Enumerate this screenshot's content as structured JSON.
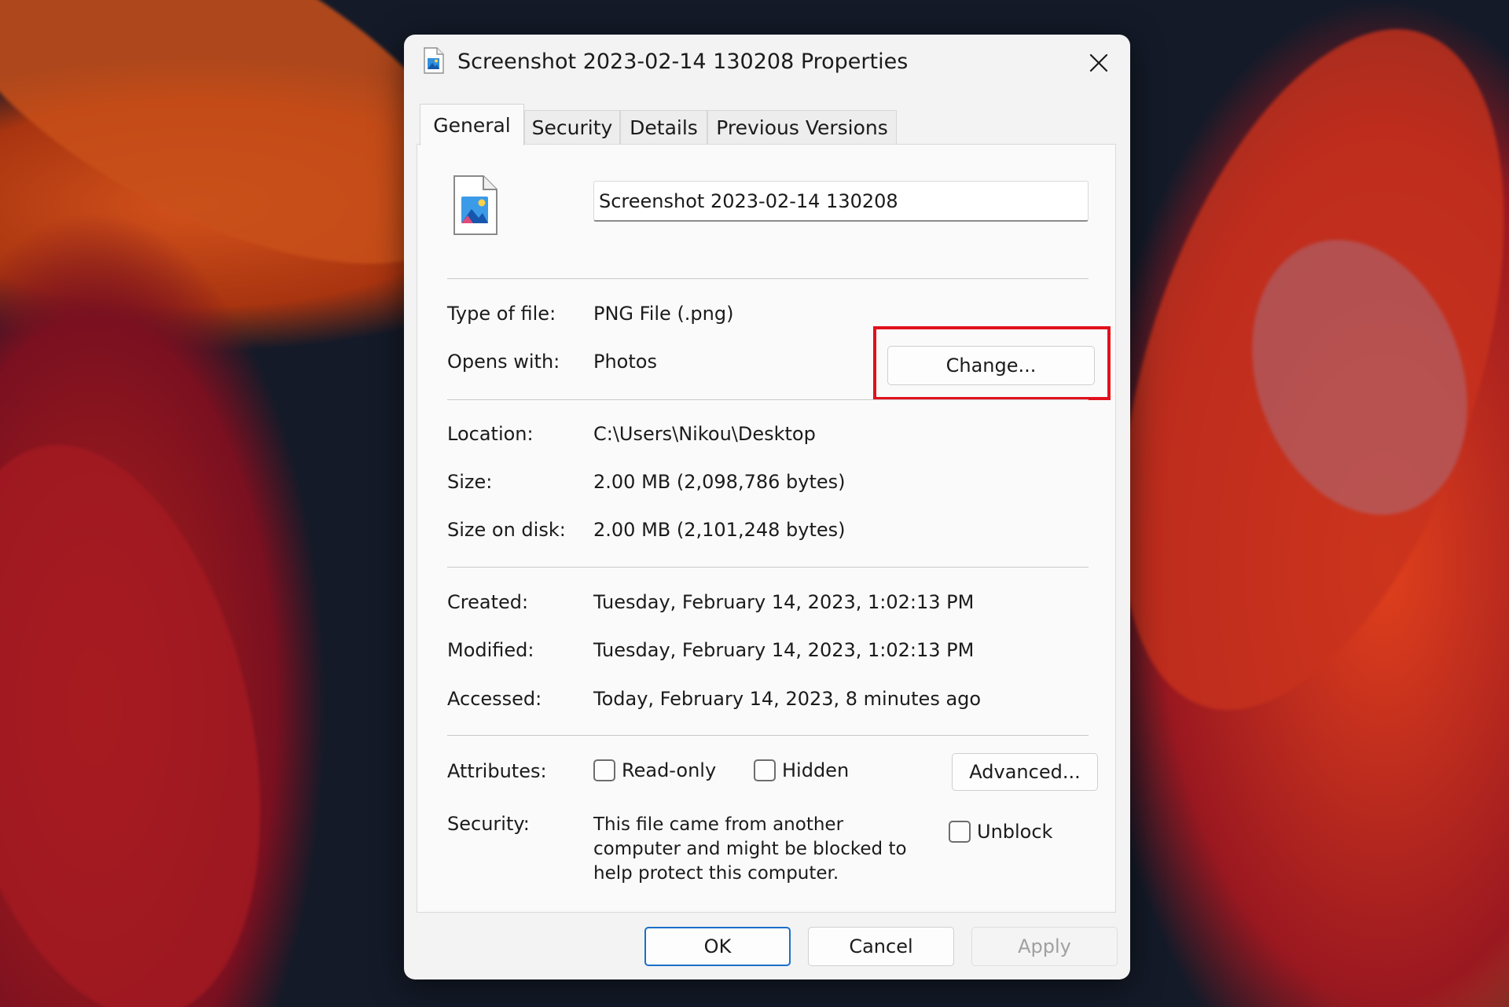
{
  "window": {
    "title": "Screenshot 2023-02-14 130208 Properties"
  },
  "tabs": [
    {
      "label": "General"
    },
    {
      "label": "Security"
    },
    {
      "label": "Details"
    },
    {
      "label": "Previous Versions"
    }
  ],
  "general": {
    "file_name": "Screenshot 2023-02-14 130208",
    "type_label": "Type of file:",
    "type_value": "PNG File (.png)",
    "opens_label": "Opens with:",
    "opens_value": "Photos",
    "change_label": "Change...",
    "location_label": "Location:",
    "location_value": "C:\\Users\\Nikou\\Desktop",
    "size_label": "Size:",
    "size_value": "2.00 MB (2,098,786 bytes)",
    "size_on_disk_label": "Size on disk:",
    "size_on_disk_value": "2.00 MB (2,101,248 bytes)",
    "created_label": "Created:",
    "created_value": "Tuesday, February 14, 2023, 1:02:13 PM",
    "modified_label": "Modified:",
    "modified_value": "Tuesday, February 14, 2023, 1:02:13 PM",
    "accessed_label": "Accessed:",
    "accessed_value": "Today, February 14, 2023, 8 minutes ago",
    "attributes_label": "Attributes:",
    "readonly_label": "Read-only",
    "hidden_label": "Hidden",
    "advanced_label": "Advanced...",
    "security_label": "Security:",
    "security_text": "This file came from another computer and might be blocked to help protect this computer.",
    "unblock_label": "Unblock"
  },
  "footer": {
    "ok_label": "OK",
    "cancel_label": "Cancel",
    "apply_label": "Apply"
  },
  "colors": {
    "highlight": "#e1111c",
    "accent": "#1a6fc9"
  }
}
